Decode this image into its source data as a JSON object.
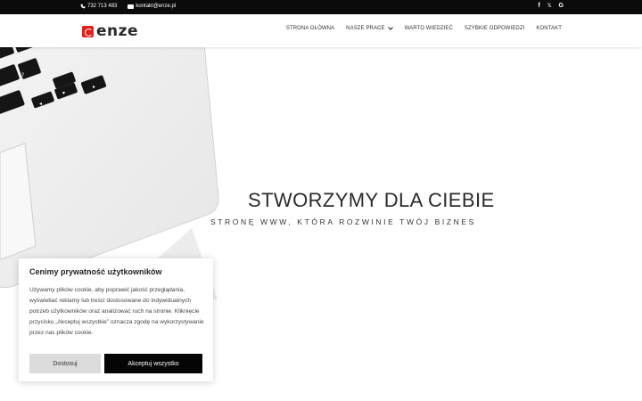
{
  "topbar": {
    "phone": "732 713 483",
    "email": "kontakt@enze.pl",
    "social": [
      {
        "name": "facebook",
        "glyph": "f"
      },
      {
        "name": "x",
        "glyph": "𝕏"
      },
      {
        "name": "google",
        "glyph": "G"
      }
    ]
  },
  "header": {
    "logo_text": "enze",
    "nav": [
      {
        "label": "Strona Główna"
      },
      {
        "label": "Nasze Prace",
        "dropdown": true
      },
      {
        "label": "Warto Wiedzieć"
      },
      {
        "label": "Szybkie odpowiedzi"
      },
      {
        "label": "Kontakt"
      }
    ]
  },
  "hero": {
    "title": "STWORZYMY DLA CIEBIE",
    "subtitle": "STRONĘ WWW, KTÓRA ROZWINIE TWÓJ BIZNES"
  },
  "cookie": {
    "title": "Cenimy prywatność użytkowników",
    "body": "Używamy plików cookie, aby poprawić jakość przeglądania, wyświetlać reklamy lub treści dostosowane do indywidualnych potrzeb użytkowników oraz analizować ruch na stronie. Kliknięcie przycisku „Akceptuj wszystkie” oznacza zgodę na wykorzystywanie przez nas plików cookie.",
    "customize_label": "Dostosuj",
    "accept_label": "Akceptuj wszystko"
  },
  "colors": {
    "topbar_bg": "#0b0b0b",
    "logo_red": "#e0201c",
    "accept_bg": "#050505",
    "customize_bg": "#dcdcdc"
  }
}
